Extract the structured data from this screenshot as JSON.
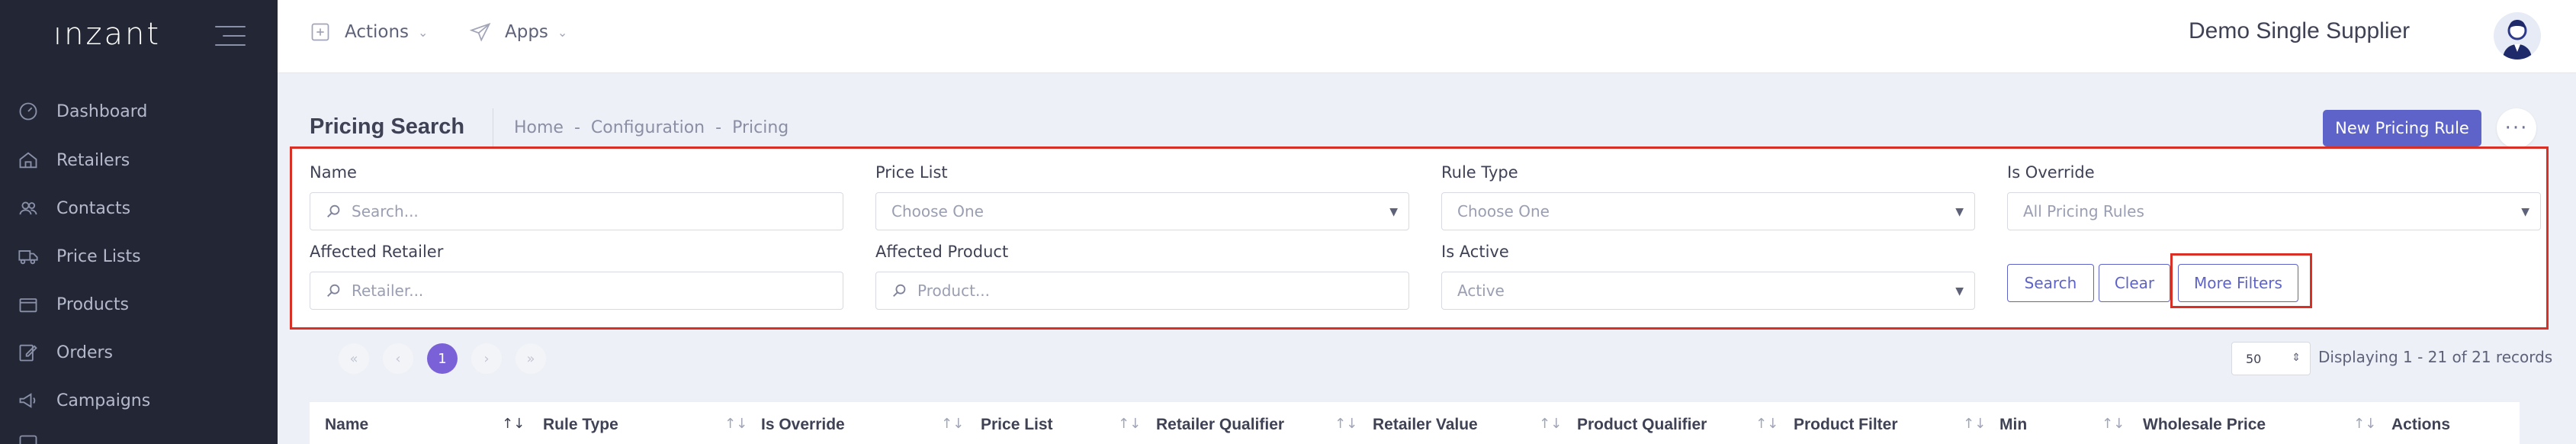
{
  "brand": {
    "name": "ınzant"
  },
  "sidebar": {
    "items": [
      {
        "label": "Dashboard",
        "icon": "dashboard-icon"
      },
      {
        "label": "Retailers",
        "icon": "home-icon"
      },
      {
        "label": "Contacts",
        "icon": "users-icon"
      },
      {
        "label": "Price Lists",
        "icon": "truck-icon"
      },
      {
        "label": "Products",
        "icon": "box-icon"
      },
      {
        "label": "Orders",
        "icon": "edit-icon"
      },
      {
        "label": "Campaigns",
        "icon": "megaphone-icon"
      }
    ]
  },
  "header": {
    "actions_label": "Actions",
    "apps_label": "Apps",
    "supplier_name": "Demo Single Supplier"
  },
  "subheader": {
    "title": "Pricing Search",
    "breadcrumb": [
      "Home",
      "-",
      "Configuration",
      "-",
      "Pricing"
    ],
    "new_button": "New Pricing Rule",
    "more_button": "···"
  },
  "filters": {
    "name": {
      "label": "Name",
      "placeholder": "Search..."
    },
    "price_list": {
      "label": "Price List",
      "value": "Choose One"
    },
    "rule_type": {
      "label": "Rule Type",
      "value": "Choose One"
    },
    "is_override": {
      "label": "Is Override",
      "value": "All Pricing Rules"
    },
    "affected_retailer": {
      "label": "Affected Retailer",
      "placeholder": "Retailer..."
    },
    "affected_product": {
      "label": "Affected Product",
      "placeholder": "Product..."
    },
    "is_active": {
      "label": "Is Active",
      "value": "Active"
    },
    "search_button": "Search",
    "clear_button": "Clear",
    "more_filters_button": "More Filters"
  },
  "pagination": {
    "current_page": "1",
    "page_size": "50",
    "records_text": "Displaying 1 - 21 of 21 records"
  },
  "table": {
    "columns": [
      "Name",
      "Rule Type",
      "Is Override",
      "Price List",
      "Retailer Qualifier",
      "Retailer Value",
      "Product Qualifier",
      "Product Filter",
      "Min",
      "Wholesale Price",
      "Actions"
    ]
  },
  "colors": {
    "primary": "#5d63c9",
    "sidebar": "#232735",
    "highlight": "#d93025",
    "active_page": "#7b61d8"
  }
}
